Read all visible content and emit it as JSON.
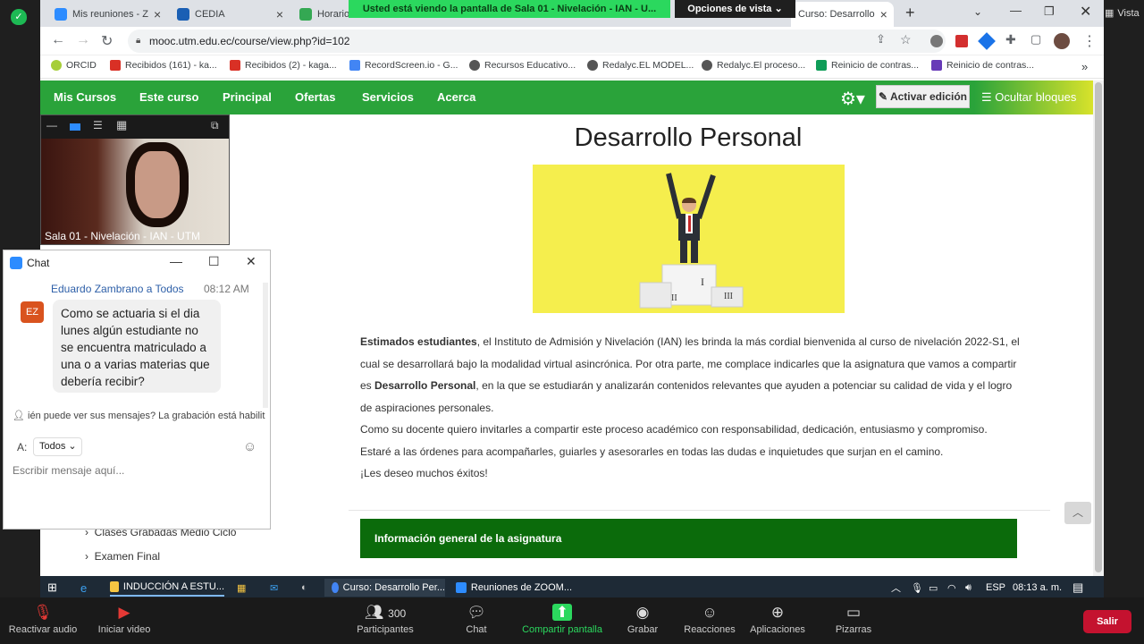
{
  "zoom": {
    "view_label": "Vista",
    "share_banner": "Usted está viendo la pantalla de Sala 01 - Nivelación - IAN - U...",
    "share_options": "Opciones de vista",
    "video_name": "Sala 01 - Nivelación - IAN - UTM",
    "toolbar": [
      {
        "label": "Reactivar audio",
        "icon": "mic-muted-icon"
      },
      {
        "label": "Iniciar video",
        "icon": "camera-off-icon"
      },
      {
        "label": "Participantes",
        "icon": "participants-icon",
        "count": "300"
      },
      {
        "label": "Chat",
        "icon": "chat-icon"
      },
      {
        "label": "Compartir pantalla",
        "icon": "share-icon"
      },
      {
        "label": "Grabar",
        "icon": "record-icon"
      },
      {
        "label": "Reacciones",
        "icon": "reactions-icon"
      },
      {
        "label": "Aplicaciones",
        "icon": "apps-icon"
      },
      {
        "label": "Pizarras",
        "icon": "whiteboard-icon"
      }
    ],
    "leave_label": "Salir"
  },
  "chat": {
    "title": "Chat",
    "from": "Eduardo Zambrano a Todos",
    "time": "08:12 AM",
    "avatar": "EZ",
    "message": "Como se actuaria si el dia lunes algún estudiante no se encuentra matriculado a una o a varias materias que debería recibir?",
    "privacy": "ién puede ver sus mensajes? La grabación está habilit",
    "to_label": "A:",
    "to_value": "Todos",
    "placeholder": "Escribir mensaje aquí..."
  },
  "browser": {
    "tabs": [
      {
        "label": "Mis reuniones - Z",
        "color": "#2d8cff"
      },
      {
        "label": "CEDIA",
        "color": "#1a5fb4"
      },
      {
        "label": "Horario",
        "color": "#34a853"
      },
      {
        "label": "Curso: Desarrollo",
        "color": "#f28b00"
      }
    ],
    "url": "mooc.utm.edu.ec/course/view.php?id=102",
    "bookmarks": [
      {
        "label": "ORCID",
        "color": "#a6ce39"
      },
      {
        "label": "Recibidos (161) - ka...",
        "color": "#d93025"
      },
      {
        "label": "Recibidos (2) - kaga...",
        "color": "#d93025"
      },
      {
        "label": "RecordScreen.io - G...",
        "color": "#4285f4"
      },
      {
        "label": "Recursos Educativo...",
        "color": "#555555"
      },
      {
        "label": "Redalyc.EL MODEL...",
        "color": "#555555"
      },
      {
        "label": "Redalyc.El proceso...",
        "color": "#555555"
      },
      {
        "label": "Reinicio de contras...",
        "color": "#0f9d58"
      },
      {
        "label": "Reinicio de contras...",
        "color": "#673ab7"
      }
    ]
  },
  "moodle": {
    "nav": [
      "Mis Cursos",
      "Este curso",
      "Principal",
      "Ofertas",
      "Servicios",
      "Acerca"
    ],
    "edit_button": "Activar edición",
    "hide_blocks": "Ocultar bloques",
    "title": "Desarrollo Personal",
    "intro_bold": "Estimados estudiantes",
    "intro_1": ", el Instituto de Admisión y Nivelación (IAN) les brinda  la más cordial bienvenida al curso de nivelación 2022-S1, el cual se desarrollará bajo la modalidad virtual asincrónica. Por otra parte, me complace indicarles que la asignatura que vamos a compartir es ",
    "course_bold": "Desarrollo Personal",
    "intro_2": ", en la que se estudiarán y analizarán contenidos relevantes que ayuden a potenciar su calidad de vida y el logro de aspiraciones personales.",
    "paragraph_2": "Como su docente quiero invitarles a compartir este proceso académico con responsabilidad, dedicación, entusiasmo y compromiso. Estaré a las órdenes para acompañarles, guiarles y asesorarles en todas las dudas e inquietudes que surjan en el camino.",
    "closing": "¡Les deseo muchos éxitos!",
    "info_header": "Información general de la asignatura",
    "side_items": [
      "Clases Grabadas Medio Ciclo",
      "Examen Final"
    ]
  },
  "taskbar": {
    "items": [
      {
        "label": "INDUCCIÓN A ESTU...",
        "color": "#f5c542"
      },
      {
        "label": "Curso: Desarrollo Per...",
        "color": "#4285f4"
      },
      {
        "label": "Reuniones de ZOOM...",
        "color": "#2d8cff"
      }
    ],
    "lang": "ESP",
    "time": "08:13 a. m."
  }
}
